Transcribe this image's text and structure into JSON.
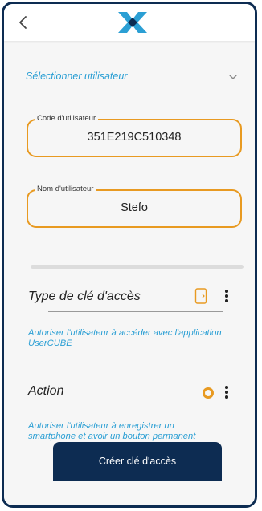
{
  "header": {
    "back_icon": "chevron-left-icon",
    "logo_icon": "brand-x-logo-icon"
  },
  "user_select": {
    "label": "Sélectionner utilisateur",
    "icon": "chevron-down-icon"
  },
  "fields": {
    "user_code": {
      "legend": "Code d'utilisateur",
      "value": "351E219C510348"
    },
    "user_name": {
      "legend": "Nom d'utilisateur",
      "value": "Stefo"
    }
  },
  "key_type": {
    "label": "Type de clé d'accès",
    "icon": "smartphone-icon",
    "description": "Autoriser l'utilisateur à accéder avec l'application UserCUBE"
  },
  "action": {
    "label": "Action",
    "icon": "radio-circle-icon",
    "description": "Autoriser l'utilisateur à enregistrer un smartphone et avoir un bouton permanent"
  },
  "footer": {
    "create_button_label": "Créer clé d'accès"
  },
  "colors": {
    "navy": "#0d2c52",
    "accent_orange": "#e89a21",
    "link_blue": "#2b9fd4"
  }
}
